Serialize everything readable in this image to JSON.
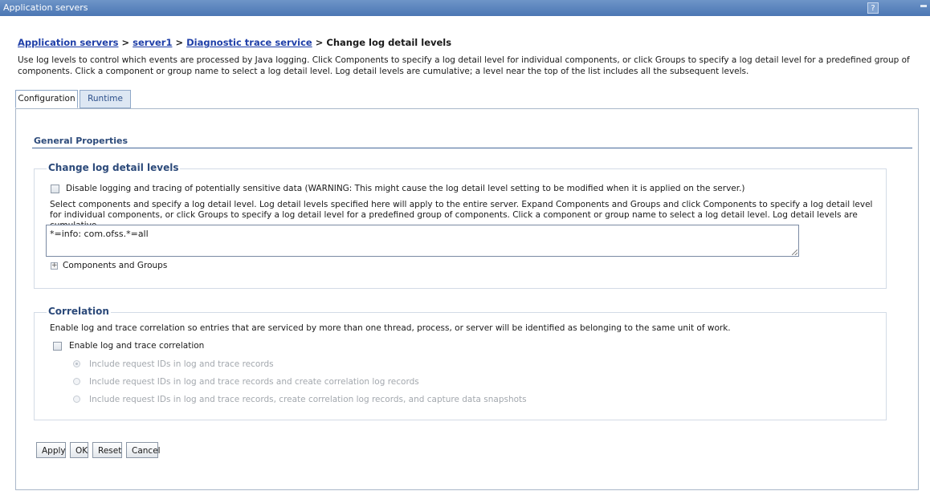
{
  "window": {
    "title": "Application servers",
    "help_label": "?"
  },
  "breadcrumb": {
    "items": [
      "Application servers",
      "server1",
      "Diagnostic trace service"
    ],
    "separator": ">",
    "current": "Change log detail levels"
  },
  "description": "Use log levels to control which events are processed by Java logging. Click Components to specify a log detail level for individual components, or click Groups to specify a log detail level for a predefined group of components. Click a component or group name to select a log detail level. Log detail levels are cumulative; a level near the top of the list includes all the subsequent levels.",
  "tabs": [
    {
      "label": "Configuration",
      "active": true
    },
    {
      "label": "Runtime",
      "active": false
    }
  ],
  "general_properties": {
    "title": "General Properties"
  },
  "log_levels": {
    "legend": "Change log detail levels",
    "disable_checkbox": {
      "label": "Disable logging and tracing of potentially sensitive data (WARNING: This might cause the log detail level setting to be modified when it is applied on the server.)",
      "checked": false
    },
    "instructions": "Select components and specify a log detail level. Log detail levels specified here will apply to the entire server. Expand Components and Groups and click Components to specify a log detail level for individual components, or click Groups to specify a log detail level for a predefined group of components. Click a component or group name to select a log detail level. Log detail levels are cumulative.",
    "spec_value": "*=info: com.ofss.*=all",
    "components_label": "Components and Groups",
    "expand_symbol": "+"
  },
  "correlation": {
    "legend": "Correlation",
    "description": "Enable log and trace correlation so entries that are serviced by more than one thread, process, or server will be identified as belonging to the same unit of work.",
    "enable_checkbox": {
      "label": "Enable log and trace correlation",
      "checked": false
    },
    "options": [
      {
        "label": "Include request IDs in log and trace records",
        "selected": true
      },
      {
        "label": "Include request IDs in log and trace records and create correlation log records",
        "selected": false
      },
      {
        "label": "Include request IDs in log and trace records, create correlation log records, and capture data snapshots",
        "selected": false
      }
    ]
  },
  "buttons": {
    "apply": "Apply",
    "ok": "OK",
    "reset": "Reset",
    "cancel": "Cancel"
  },
  "colors": {
    "title_bar": "#4b76b3",
    "link": "#1f3fa8",
    "section_heading": "#2c4a7a",
    "disabled_text": "#a3a8ae"
  }
}
